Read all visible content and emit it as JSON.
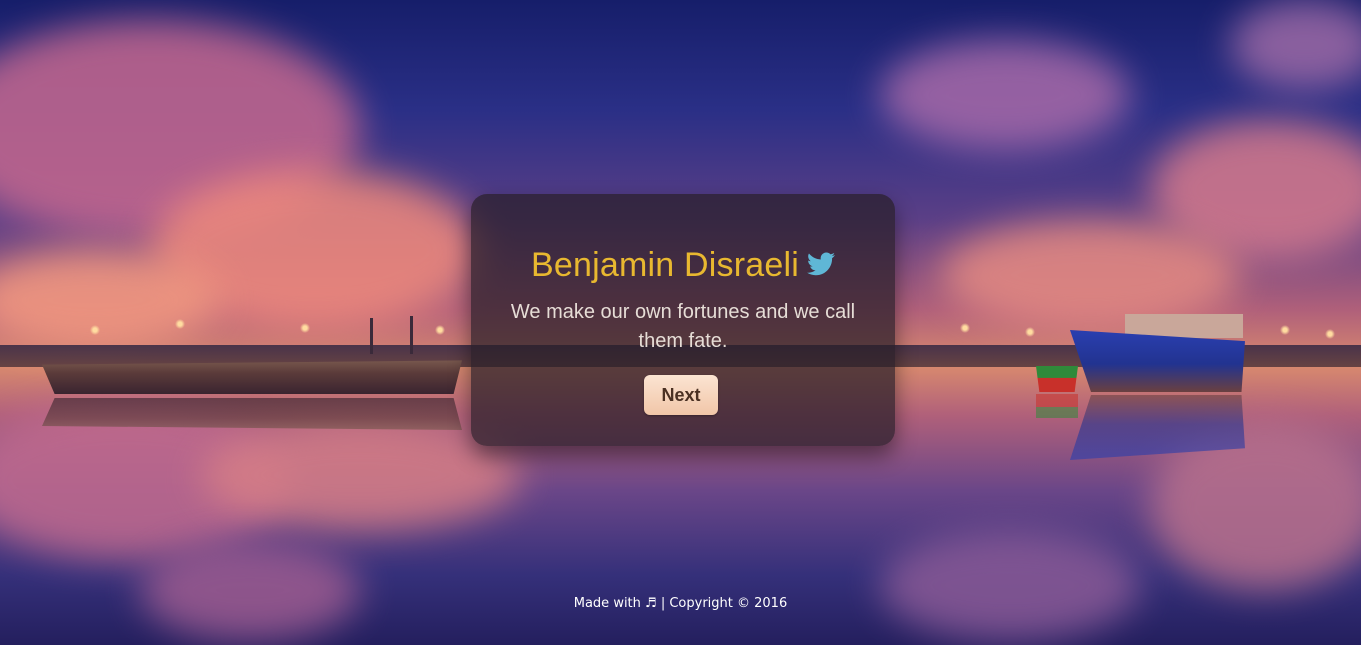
{
  "quote": {
    "author": "Benjamin Disraeli",
    "text": "We make our own fortunes and we call them fate."
  },
  "controls": {
    "next_label": "Next"
  },
  "footer": {
    "made_with": "Made with",
    "music_symbol": "♬",
    "copyright": "| Copyright © 2016"
  },
  "icons": {
    "author_icon": "twitter-icon",
    "footer_icon": "music-note-icon"
  },
  "colors": {
    "author": "#e8b830",
    "twitter": "#5fb7d6",
    "card_background": "rgba(40, 30, 40, 0.72)",
    "button_background": "#f6d5bd",
    "button_text": "#4a3022"
  },
  "background": {
    "scene": "harbor-sunset"
  }
}
